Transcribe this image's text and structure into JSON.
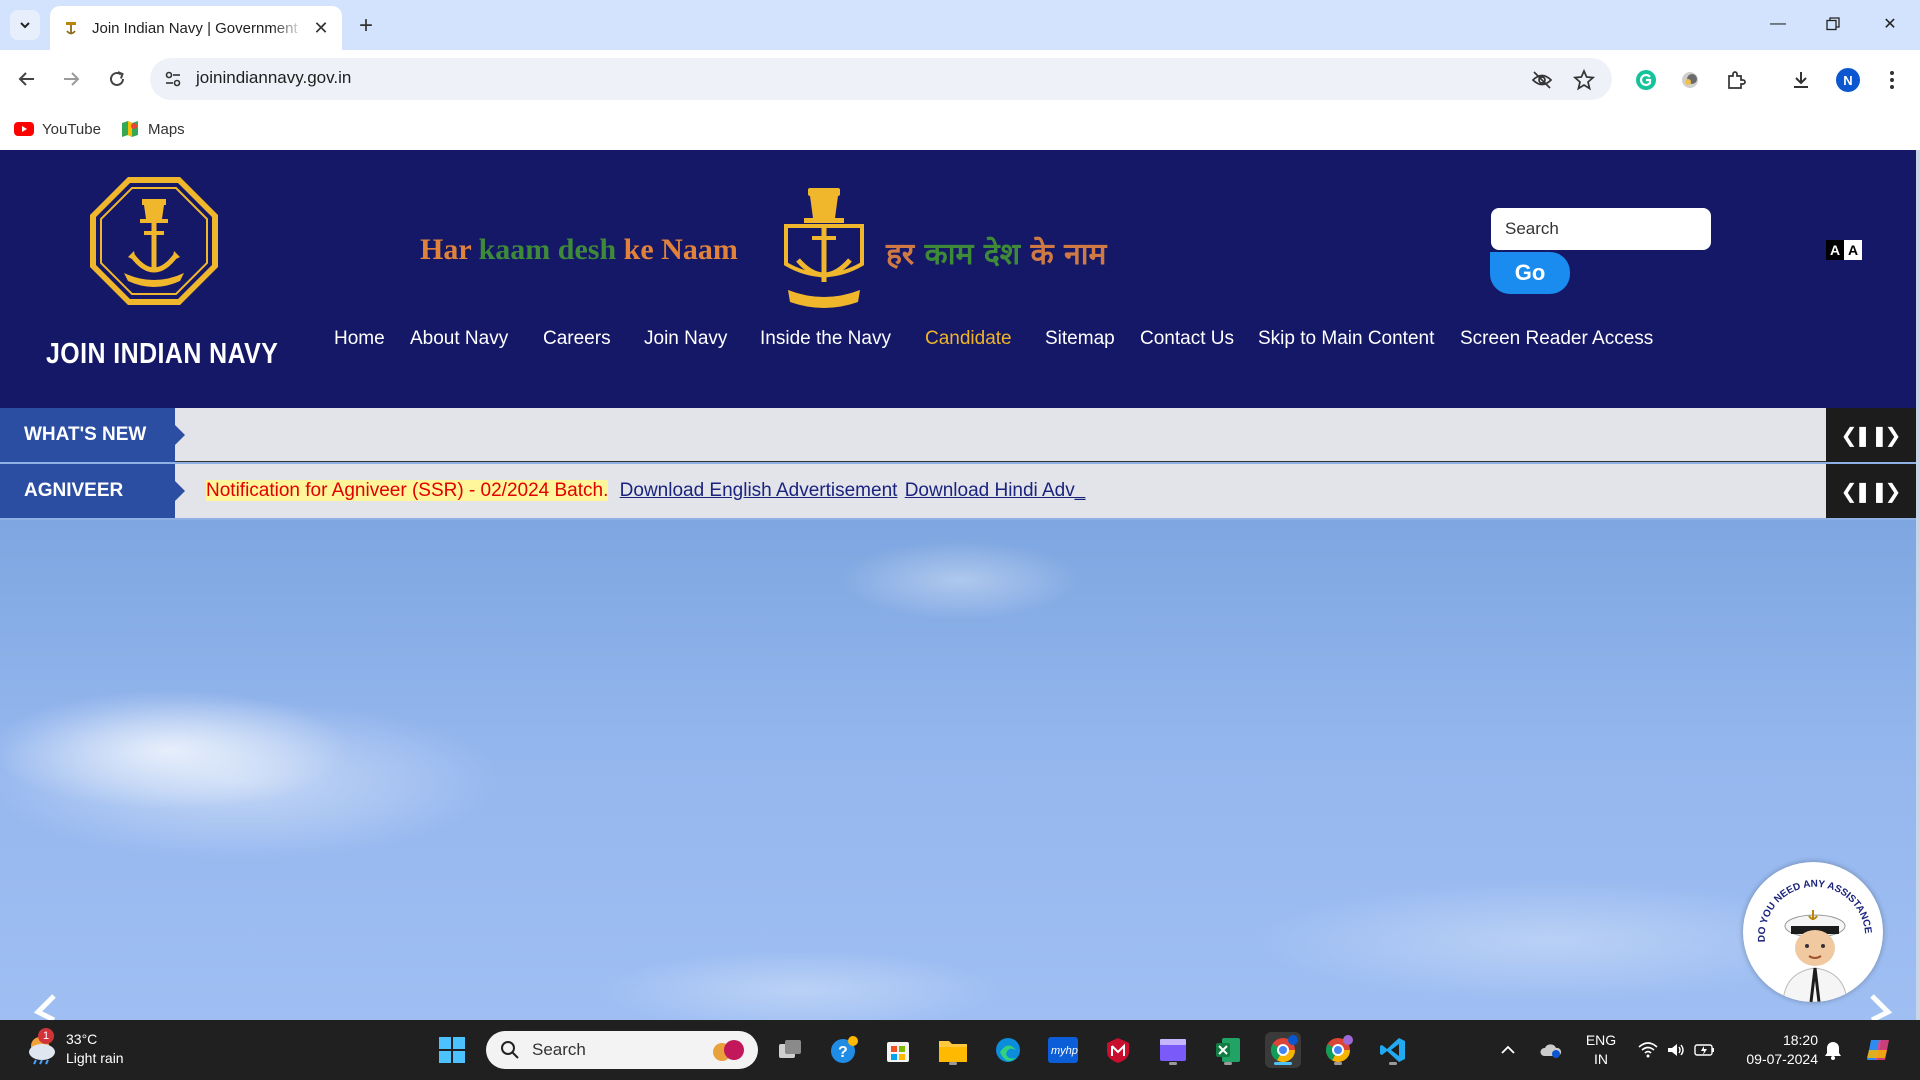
{
  "browser": {
    "tab_title": "Join Indian Navy | Government",
    "url": "joinindiannavy.gov.in",
    "profile_initial": "N",
    "bookmarks": [
      {
        "label": "YouTube",
        "icon": "youtube-icon"
      },
      {
        "label": "Maps",
        "icon": "maps-icon"
      }
    ]
  },
  "header": {
    "site_name": "JOIN INDIAN NAVY",
    "tagline_en": {
      "part1": "Har ",
      "part2": "kaam desh",
      "part3": " ke Naam"
    },
    "tagline_hi": {
      "part1": "हर ",
      "part2": "काम देश",
      "part3": " के नाम"
    },
    "search_placeholder": "Search",
    "go_label": "Go",
    "font_toggle": {
      "dark": "A",
      "light": "A"
    }
  },
  "nav": {
    "items": [
      {
        "label": "Home",
        "active": false
      },
      {
        "label": "About Navy",
        "active": false
      },
      {
        "label": "Careers",
        "active": false
      },
      {
        "label": "Join Navy",
        "active": false
      },
      {
        "label": "Inside the Navy",
        "active": false
      },
      {
        "label": "Candidate",
        "active": true
      },
      {
        "label": "Sitemap",
        "active": false
      },
      {
        "label": "Contact Us",
        "active": false
      },
      {
        "label": "Skip to Main Content",
        "active": false
      },
      {
        "label": "Screen Reader Access",
        "active": false
      }
    ]
  },
  "tickers": {
    "whats_new": {
      "label": "WHAT'S NEW",
      "text": ""
    },
    "agniveer": {
      "label": "AGNIVEER",
      "highlight": "Notification for Agniveer (SSR) - 02/2024 Batch.",
      "link1": "Download English Advertisement",
      "link2": "Download Hindi Adv_"
    }
  },
  "assistant": {
    "badge_text": "DO YOU NEED ANY ASSISTANCE?"
  },
  "taskbar": {
    "weather_temp": "33°C",
    "weather_desc": "Light rain",
    "weather_alert": "1",
    "search_placeholder": "Search",
    "lang_line1": "ENG",
    "lang_line2": "IN",
    "time": "18:20",
    "date": "09-07-2024"
  },
  "colors": {
    "header_bg": "#141867",
    "accent_gold": "#f0b429",
    "ticker_label_bg": "#2b4ea3",
    "go_button": "#1a8cf0"
  }
}
